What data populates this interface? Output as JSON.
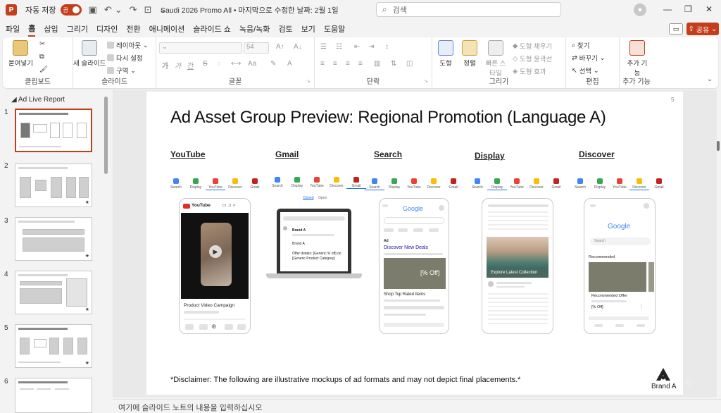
{
  "app": {
    "autosave_label": "자동 저장",
    "autosave_state": "끔",
    "doc_title": "Saudi 2026 Promo All • 마지막으로 수정한 날짜: 2월 1일",
    "search_placeholder": "검색",
    "accent_color": "#c43e1c"
  },
  "menu": {
    "items": [
      "파일",
      "홈",
      "삽입",
      "그리기",
      "디자인",
      "전환",
      "애니메이션",
      "슬라이드 쇼",
      "녹음/녹화",
      "검토",
      "보기",
      "도움말"
    ],
    "share_label": "공유"
  },
  "ribbon": {
    "clipboard": {
      "paste": "붙여넣기",
      "label": "클립보드"
    },
    "slides": {
      "new_slide": "새 슬라이드",
      "layout": "레이아웃",
      "reset": "다시 설정",
      "section": "구역",
      "label": "슬라이드"
    },
    "font": {
      "size": "54",
      "label": "글꼴",
      "bold": "가",
      "italic": "가",
      "underline": "간",
      "strike": "S"
    },
    "paragraph": {
      "label": "단락"
    },
    "drawing": {
      "shapes": "도형",
      "arrange": "정렬",
      "quick_styles": "빠른 스타일",
      "fill": "도형 채우기",
      "outline": "도형 윤곽선",
      "effects": "도형 효과",
      "label": "그리기"
    },
    "editing": {
      "find": "찾기",
      "replace": "바꾸기",
      "select": "선택",
      "label": "편집"
    },
    "addins": {
      "addins": "추가 기능",
      "label": "추가 기능"
    }
  },
  "slides_panel": {
    "section_name": "Ad Live Report",
    "numbers": [
      "1",
      "2",
      "3",
      "4",
      "5",
      "6"
    ]
  },
  "slide": {
    "number": "5",
    "title": "Ad Asset Group Preview: Regional Promotion (Language A)",
    "columns": [
      "YouTube",
      "Gmail",
      "Search",
      "Display",
      "Discover"
    ],
    "chips": [
      "Search",
      "Display",
      "YouTube",
      "Discover",
      "Gmail"
    ],
    "youtube": {
      "brand": "YouTube",
      "caption": "Product Video Campaign"
    },
    "gmail": {
      "tab1": "Closed",
      "tab2": "Open",
      "sender1": "Brand A",
      "sender2": "Brand A",
      "offer": "Offer details: [Generic % off] on [Generic Product Category]"
    },
    "search": {
      "google": "Google",
      "ad_label": "Ad",
      "headline": "Discover New Deals",
      "badge": "[% Off]",
      "caption": "Shop Top Rated Items"
    },
    "display": {
      "cta": "Explore Latest Collection"
    },
    "discover": {
      "google": "Google",
      "search_hint": "Search",
      "recommended": "Recommended",
      "offer": "Recommended Offer",
      "pct": "[% Off]"
    },
    "disclaimer": "*Disclaimer: The following are illustrative mockups of ad formats and may not depict final placements.*",
    "brand": "Brand A"
  },
  "notes_placeholder": "여기에 슬라이드 노트의 내용을 입력하십시오"
}
